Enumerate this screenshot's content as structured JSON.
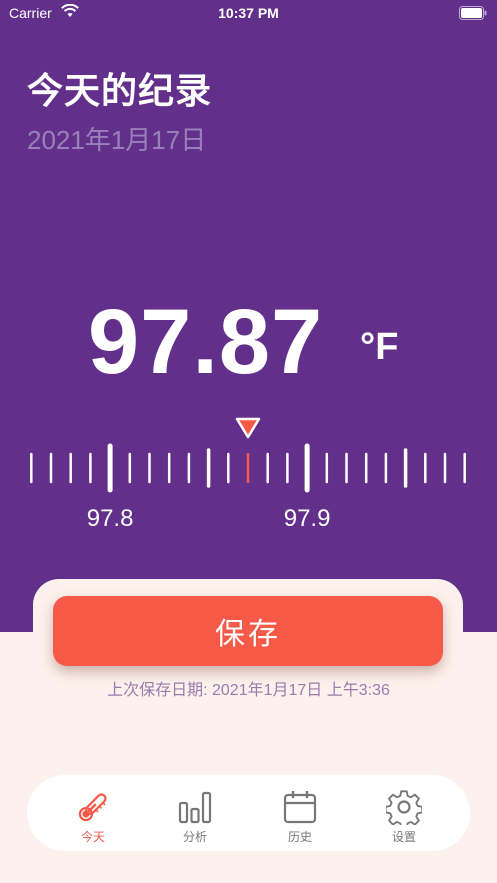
{
  "status_bar": {
    "carrier": "Carrier",
    "time": "10:37 PM"
  },
  "header": {
    "title": "今天的纪录",
    "date": "2021年1月17日"
  },
  "temperature": {
    "value": "97.87",
    "unit": "°F",
    "selected": 97.87
  },
  "ruler": {
    "min": 97.7,
    "max": 98.0,
    "step": 0.01,
    "labels": [
      "97.8",
      "97.9"
    ]
  },
  "actions": {
    "save_label": "保存",
    "last_saved": "上次保存日期: 2021年1月17日 上午3:36"
  },
  "tabs": [
    {
      "label": "今天",
      "icon": "thermometer-icon",
      "active": true
    },
    {
      "label": "分析",
      "icon": "bar-chart-icon",
      "active": false
    },
    {
      "label": "历史",
      "icon": "calendar-icon",
      "active": false
    },
    {
      "label": "设置",
      "icon": "gear-icon",
      "active": false
    }
  ],
  "colors": {
    "primary": "#62308a",
    "accent": "#f55a48",
    "background": "#fcf1ec",
    "muted": "#9b7ab0"
  }
}
